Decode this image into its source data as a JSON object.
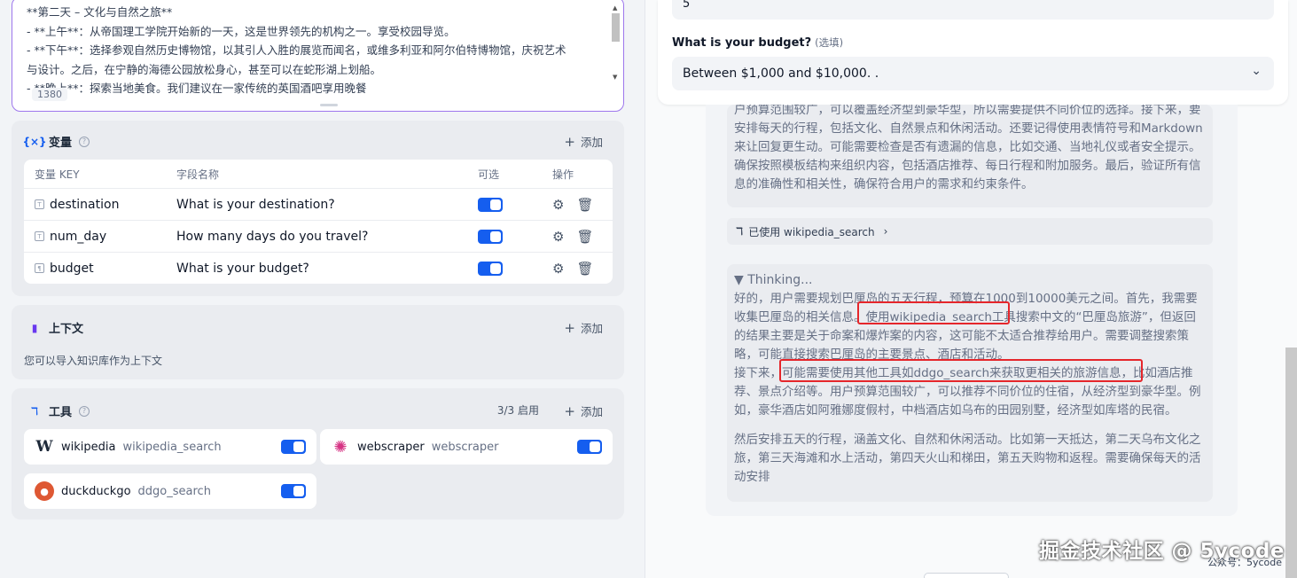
{
  "prompt": {
    "lines": [
      "**第二天 – 文化与自然之旅**",
      "- **上午**：从帝国理工学院开始新的一天，这是世界领先的机构之一。享受校园导览。",
      "- **下午**：选择参观自然历史博物馆，以其引人入胜的展览而闻名，或维多利亚和阿尔伯特博物馆，庆祝艺术",
      "与设计。之后，在宁静的海德公园放松身心，甚至可以在蛇形湖上划船。",
      "- **晚上**：探索当地美食。我们建议在一家传统的英国酒吧享用晚餐"
    ],
    "count": "1380"
  },
  "variables": {
    "title": "变量",
    "add": "添加",
    "columns": [
      "变量 KEY",
      "字段名称",
      "可选",
      "操作"
    ],
    "rows": [
      {
        "key": "destination",
        "name": "What is your destination?"
      },
      {
        "key": "num_day",
        "name": "How many days do you travel?"
      },
      {
        "key": "budget",
        "name": "What is your budget?"
      }
    ]
  },
  "context": {
    "title": "上下文",
    "add": "添加",
    "desc": "您可以导入知识库作为上下文"
  },
  "tools": {
    "title": "工具",
    "count": "3/3 启用",
    "add": "添加",
    "items": [
      {
        "name": "wikipedia",
        "sub": "wikipedia_search"
      },
      {
        "name": "webscraper",
        "sub": "webscraper"
      },
      {
        "name": "duckduckgo",
        "sub": "ddgo_search"
      }
    ]
  },
  "form": {
    "top_value": "5",
    "budget_label": "What is your budget?",
    "budget_optional": "(选填)",
    "budget_value": "Between $1,000 and $10,000. ."
  },
  "chat": {
    "block1": "户预算范围较广，可以覆盖经济型到豪华型，所以需要提供不同价位的选择。接下来，要安排每天的行程，包括文化、自然景点和休闲活动。还要记得使用表情符号和Markdown来让回复更生动。可能需要检查是否有遗漏的信息，比如交通、当地礼仪或者安全提示。确保按照模板结构来组织内容，包括酒店推荐、每日行程和附加服务。最后，验证所有信息的准确性和相关性，确保符合用户的需求和约束条件。",
    "tool_used": "已使用 wikipedia_search",
    "thinking_title": "▼ Thinking...",
    "p1": "好的，用户需要规划巴厘岛的五天行程，预算在1000到10000美元之间。首先，我需要收集巴厘岛的相关信息。使用wikipedia_search工具搜索中文的“巴厘岛旅游”，但返回的结果主要是关于命案和爆炸案的内容，这可能不太适合推荐给用户。需要调整搜索策略，可能直接搜索巴厘岛的主要景点、酒店和活动。",
    "p2": "接下来，可能需要使用其他工具如ddgo_search来获取更相关的旅游信息，比如酒店推荐、景点介绍等。用户预算范围较广，可以推荐不同价位的住宿，从经济型到豪华型。例如，豪华酒店如阿雅娜度假村，中档酒店如乌布的田园别墅，经济型如库塔的民宿。",
    "p3": "然后安排五天的行程，涵盖文化、自然和休闲活动。比如第一天抵达，第二天乌布文化之旅，第三天海滩和水上活动，第四天火山和梯田，第五天购物和返程。需要确保每天的活动安排"
  },
  "watermark": {
    "main": "掘金技术社区 @ 5ycode",
    "sub": "公众号：5ycode"
  },
  "colors": {
    "accent": "#155eef",
    "highlight": "#e5262b",
    "prompt_border": "#9e77ed"
  }
}
